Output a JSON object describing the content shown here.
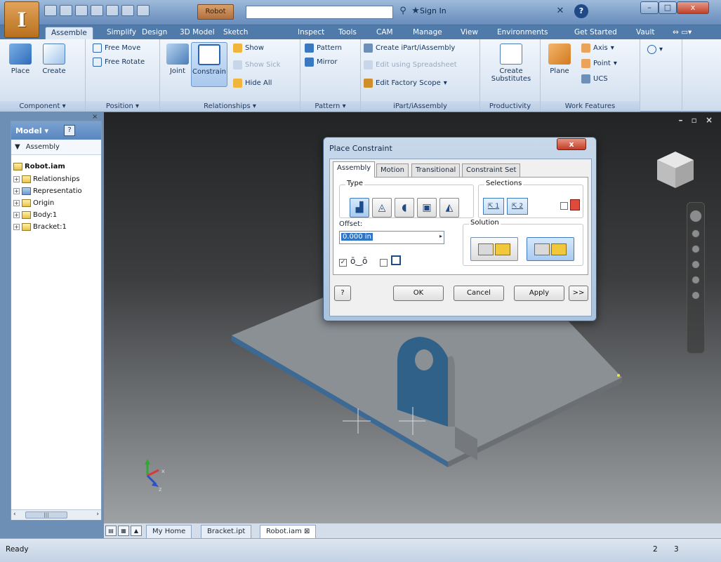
{
  "title_bar": {
    "document": "Robot",
    "sign_in": "Sign In",
    "close_label": "x",
    "min_label": "–",
    "max_label": "□"
  },
  "ribbon_tabs": [
    "Assemble",
    "Simplify",
    "Design",
    "3D Model",
    "Sketch",
    "Inspect",
    "Tools",
    "CAM",
    "Manage",
    "View",
    "Environments",
    "Get Started",
    "Vault"
  ],
  "active_tab": "Assemble",
  "ribbon": {
    "component": {
      "label": "Component",
      "place": "Place",
      "create": "Create"
    },
    "position": {
      "label": "Position",
      "free_move": "Free Move",
      "free_rotate": "Free Rotate"
    },
    "relationships": {
      "label": "Relationships",
      "joint": "Joint",
      "constrain": "Constrain",
      "show": "Show",
      "show_sick": "Show Sick",
      "hide_all": "Hide All"
    },
    "pattern": {
      "label": "Pattern",
      "pattern": "Pattern",
      "mirror": "Mirror"
    },
    "ipart": {
      "label": "iPart/iAssembly",
      "create": "Create iPart/iAssembly",
      "edit_spreadsheet": "Edit using Spreadsheet",
      "edit_factory": "Edit Factory Scope"
    },
    "productivity": {
      "label": "Productivity",
      "create_substitutes_1": "Create",
      "create_substitutes_2": "Substitutes"
    },
    "work_features": {
      "label": "Work Features",
      "plane": "Plane",
      "axis": "Axis",
      "point": "Point",
      "ucs": "UCS"
    }
  },
  "browser": {
    "title": "Model",
    "filter": "Assembly",
    "root": "Robot.iam",
    "items": [
      "Relationships",
      "Representatio",
      "Origin",
      "Body:1",
      "Bracket:1"
    ]
  },
  "dialog": {
    "title": "Place Constraint",
    "tabs": [
      "Assembly",
      "Motion",
      "Transitional",
      "Constraint Set"
    ],
    "active_tab": "Assembly",
    "type_label": "Type",
    "selections_label": "Selections",
    "selection_1": "1",
    "selection_2": "2",
    "offset_label": "Offset:",
    "offset_value": "0.000 in",
    "solution_label": "Solution",
    "ok": "OK",
    "cancel": "Cancel",
    "apply": "Apply",
    "more": ">>"
  },
  "doc_tabs": [
    "My Home",
    "Bracket.ipt",
    "Robot.iam"
  ],
  "active_doc_tab": "Robot.iam",
  "status": {
    "text": "Ready",
    "num1": "2",
    "num2": "3"
  },
  "colors": {
    "accent": "#3f7ac2",
    "ribbon_bg": "#dbe6f3",
    "title_bar": "#7b9dc7",
    "model_gray": "#8c9195",
    "bracket_blue": "#2e5f86",
    "close_red": "#c33d25"
  }
}
